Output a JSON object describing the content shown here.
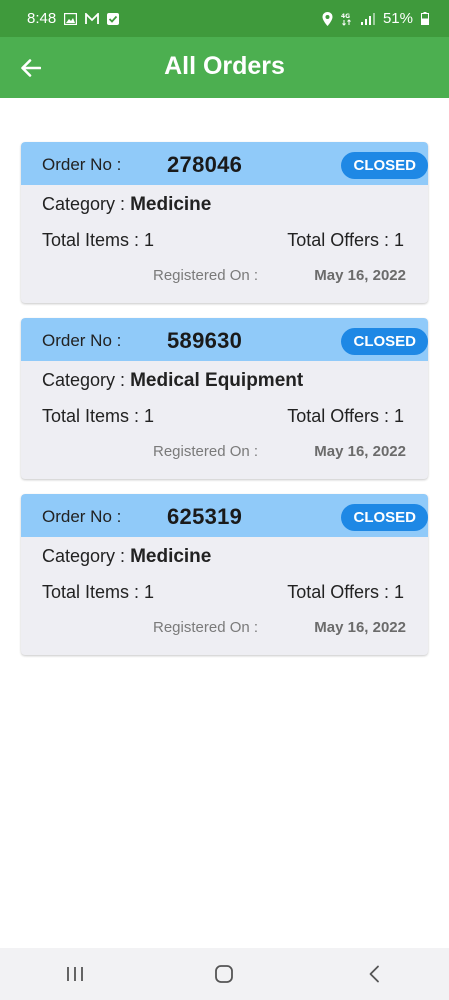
{
  "status_bar": {
    "time": "8:48",
    "battery": "51%",
    "network": "4G"
  },
  "app_bar": {
    "title": "All Orders"
  },
  "orders": [
    {
      "order_label": "Order No :",
      "order_no": "278046",
      "status": "CLOSED",
      "category_label": "Category :",
      "category": "Medicine",
      "total_items": "Total Items : 1",
      "total_offers": "Total Offers : 1",
      "registered_label": "Registered On :",
      "registered_date": "May 16, 2022"
    },
    {
      "order_label": "Order No :",
      "order_no": "589630",
      "status": "CLOSED",
      "category_label": "Category :",
      "category": "Medical Equipment",
      "total_items": "Total Items : 1",
      "total_offers": "Total Offers : 1",
      "registered_label": "Registered On :",
      "registered_date": "May 16, 2022"
    },
    {
      "order_label": "Order No :",
      "order_no": "625319",
      "status": "CLOSED",
      "category_label": "Category :",
      "category": "Medicine",
      "total_items": "Total Items : 1",
      "total_offers": "Total Offers : 1",
      "registered_label": "Registered On :",
      "registered_date": "May 16, 2022"
    }
  ],
  "icons": {
    "back": "arrow-left-icon",
    "recents": "recents-icon",
    "home": "home-icon",
    "nav_back": "chevron-left-icon"
  },
  "colors": {
    "status_bar": "#3f9a3c",
    "app_bar": "#4caf50",
    "card_header": "#90caf9",
    "badge": "#1e88e5",
    "card_bg": "#eeeef3"
  }
}
